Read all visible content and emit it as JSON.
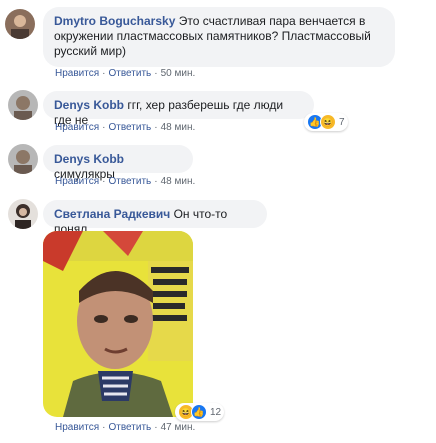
{
  "comments": [
    {
      "author": "Dmytro Bogucharsky",
      "text": "Это счастливая пара венчается в окружении пластмассовых памятников? Пластмассовый русский мир)",
      "actions": {
        "like": "Нравится",
        "reply": "Ответить",
        "time": "50 мин."
      }
    },
    {
      "author": "Denys Kobb",
      "text": "ггг, хер разберешь где люди где не",
      "actions": {
        "like": "Нравится",
        "reply": "Ответить",
        "time": "48 мин."
      },
      "reactions": {
        "icons": [
          "like-icon",
          "haha-icon"
        ],
        "count": "7"
      }
    },
    {
      "author": "Denys Kobb",
      "text": "симулякры",
      "actions": {
        "like": "Нравится",
        "reply": "Ответить",
        "time": "48 мин."
      }
    },
    {
      "author": "Светлана Радкевич",
      "text": "Он что-то понял",
      "actions": {
        "like": "Нравится",
        "reply": "Ответить",
        "time": "47 мин."
      },
      "reactions": {
        "icons": [
          "haha-icon",
          "like-icon"
        ],
        "count": "12"
      }
    }
  ],
  "sep": "·",
  "colors": {
    "link": "#385898",
    "bubble": "#f2f3f5",
    "meta": "#606770"
  }
}
